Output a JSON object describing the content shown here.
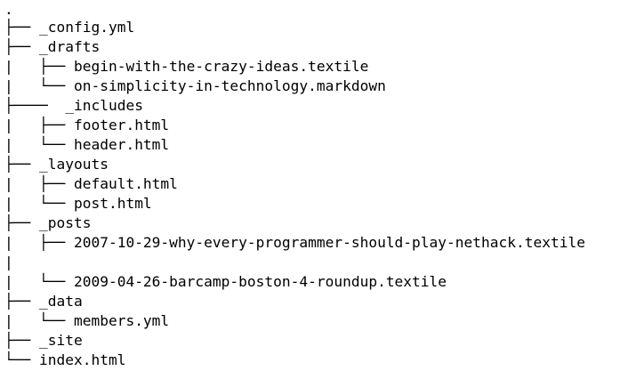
{
  "tree": {
    "rows": [
      {
        "prefix": ".",
        "name": ""
      },
      {
        "prefix": "├── ",
        "name": "_config.yml"
      },
      {
        "prefix": "├── ",
        "name": "_drafts"
      },
      {
        "prefix": "|   ├── ",
        "name": "begin-with-the-crazy-ideas.textile"
      },
      {
        "prefix": "|   └── ",
        "name": "on-simplicity-in-technology.markdown"
      },
      {
        "prefix": "├────  ",
        "name": "_includes"
      },
      {
        "prefix": "|   ├── ",
        "name": "footer.html"
      },
      {
        "prefix": "|   └── ",
        "name": "header.html"
      },
      {
        "prefix": "├── ",
        "name": "_layouts"
      },
      {
        "prefix": "|   ├── ",
        "name": "default.html"
      },
      {
        "prefix": "|   └── ",
        "name": "post.html"
      },
      {
        "prefix": "├── ",
        "name": "_posts"
      },
      {
        "prefix": "|   ├── ",
        "name": "2007-10-29-why-every-programmer-should-play-nethack.textile"
      },
      {
        "prefix": "|   └── ",
        "name": "2009-04-26-barcamp-boston-4-roundup.textile"
      },
      {
        "prefix": "├── ",
        "name": "_data"
      },
      {
        "prefix": "|   └── ",
        "name": "members.yml"
      },
      {
        "prefix": "├── ",
        "name": "_site"
      },
      {
        "prefix": "└── ",
        "name": "index.html"
      }
    ]
  }
}
